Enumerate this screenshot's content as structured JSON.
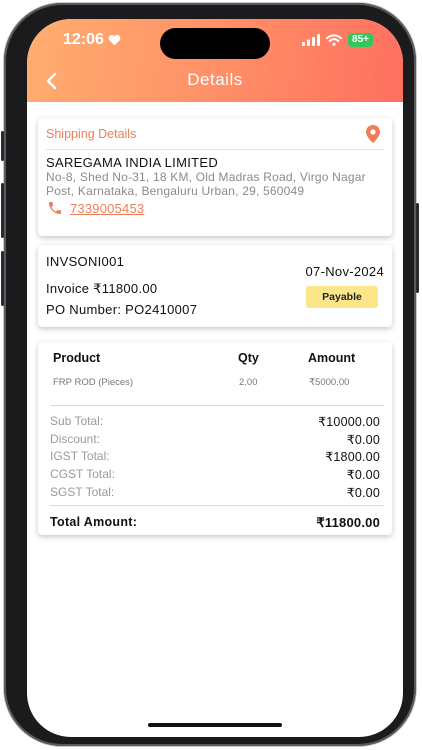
{
  "status_bar": {
    "time": "12:06",
    "battery": "85+"
  },
  "header": {
    "title": "Details"
  },
  "shipping": {
    "label": "Shipping Details",
    "company": "SAREGAMA INDIA LIMITED",
    "address": "No-8, Shed No-31, 18 KM, Old Madras Road, Virgo Nagar Post, Karnataka, Bengaluru Urban, 29, 560049",
    "phone": "7339005453"
  },
  "invoice": {
    "number": "INVSONI001",
    "date": "07-Nov-2024",
    "amount": "Invoice ₹11800.00",
    "po": "PO Number: PO2410007",
    "status": "Payable"
  },
  "products": {
    "headers": {
      "product": "Product",
      "qty": "Qty",
      "amount": "Amount"
    },
    "rows": [
      {
        "product": "FRP ROD (Pieces)",
        "qty": "2.00",
        "amount": "₹5000.00"
      }
    ]
  },
  "summary": {
    "sub_total_label": "Sub Total:",
    "sub_total": "₹10000.00",
    "discount_label": "Discount:",
    "discount": "₹0.00",
    "igst_label": "IGST Total:",
    "igst": "₹1800.00",
    "cgst_label": "CGST Total:",
    "cgst": "₹0.00",
    "sgst_label": "SGST Total:",
    "sgst": "₹0.00",
    "total_label": "Total Amount:",
    "total": "₹11800.00"
  },
  "colors": {
    "accent": "#f07d5a",
    "header_start": "#ffae6f",
    "header_end": "#ff6f60",
    "badge": "#fde68a"
  },
  "icons": [
    "back-chevron-icon",
    "location-pin-icon",
    "phone-icon",
    "signal-icon",
    "wifi-icon",
    "heart-icon"
  ]
}
